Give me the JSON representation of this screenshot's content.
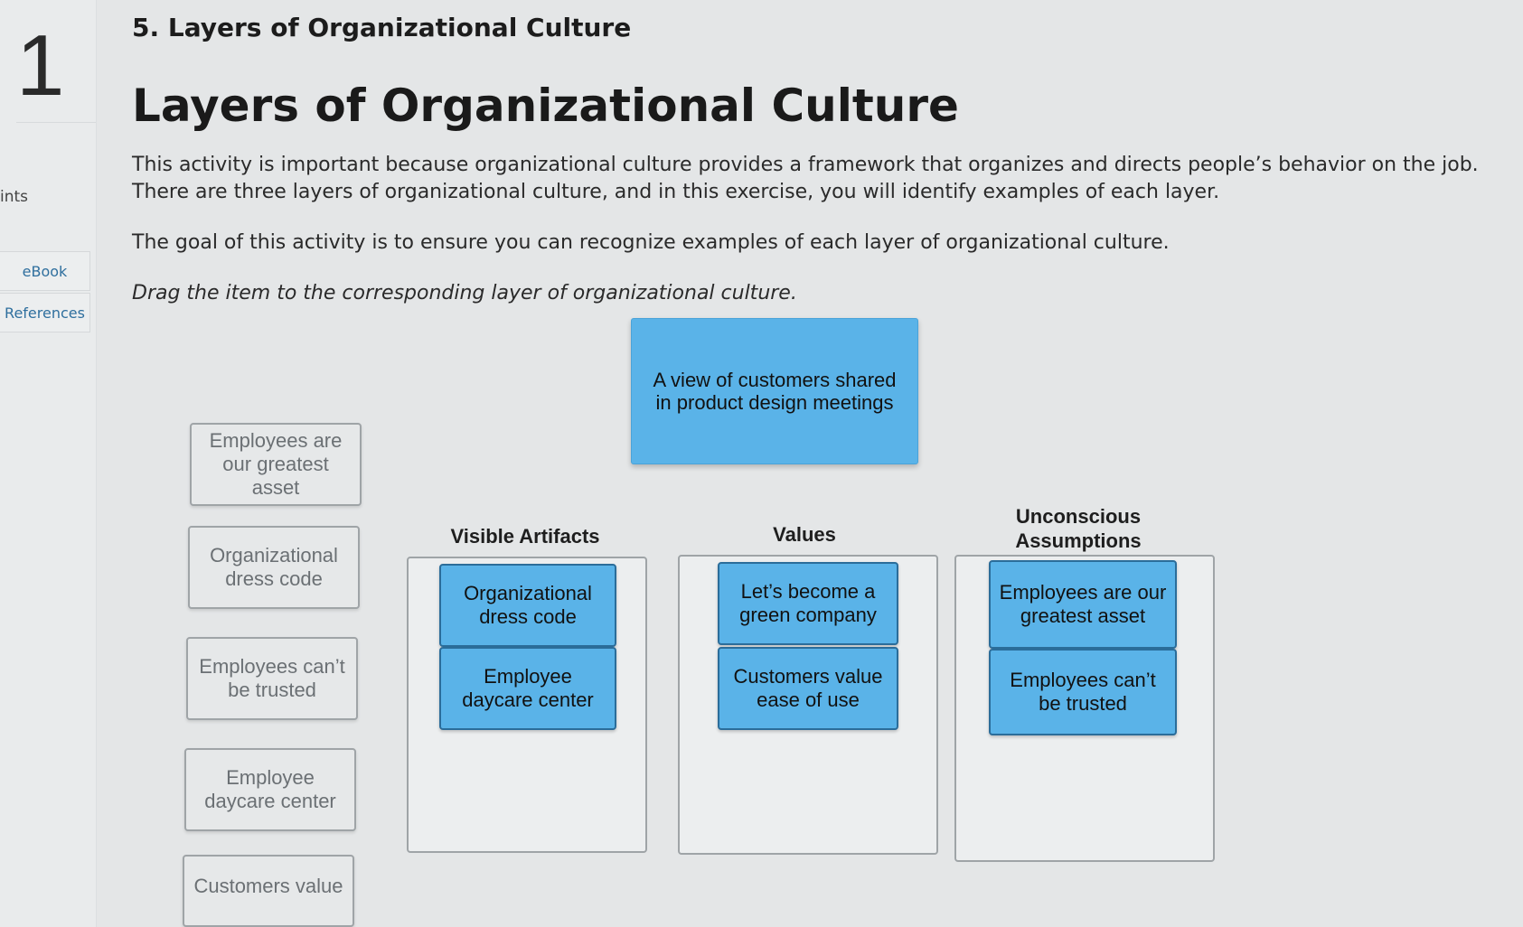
{
  "sidebar": {
    "question_number": "1",
    "points_label": "ints",
    "links": [
      {
        "label": "eBook"
      },
      {
        "label": "References"
      }
    ]
  },
  "question": {
    "title": "5. Layers of Organizational Culture",
    "heading": "Layers of Organizational Culture",
    "paragraph1": "This activity is important because organizational culture provides a framework that organizes and directs people’s behavior on the job. There are three layers of organizational culture, and in this exercise, you will identify examples of each layer.",
    "paragraph2": "The goal of this activity is to ensure you can recognize examples of each layer of organizational culture.",
    "instruction": "Drag the item to the corresponding layer of organizational culture."
  },
  "dragging_item": {
    "label": "A view of customers shared in product design meetings"
  },
  "source_items": [
    {
      "label": "Employees are our greatest asset"
    },
    {
      "label": "Organizational dress code"
    },
    {
      "label": "Employees can’t be trusted"
    },
    {
      "label": "Employee daycare center"
    },
    {
      "label": "Customers value"
    }
  ],
  "zones": [
    {
      "label": "Visible Artifacts",
      "items": [
        "Organizational dress code",
        "Employee daycare center"
      ]
    },
    {
      "label": "Values",
      "items": [
        "Let’s become a green company",
        "Customers value ease of use"
      ]
    },
    {
      "label": "Unconscious Assumptions",
      "items": [
        "Employees are our greatest asset",
        "Employees can’t be trusted"
      ]
    }
  ],
  "colors": {
    "placed_card": "#5ab3e8",
    "link": "#2f6f9e"
  }
}
